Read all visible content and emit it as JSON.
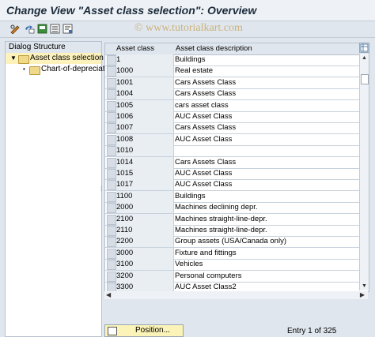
{
  "window": {
    "title": "Change View \"Asset class selection\": Overview"
  },
  "watermark": "© www.tutorialkart.com",
  "toolbar": {
    "icons": [
      "glasses-edit-icon",
      "change-display-icon",
      "save-list-icon",
      "previous-entry-icon",
      "next-entry-icon"
    ]
  },
  "dialog_structure": {
    "header": "Dialog Structure",
    "nodes": [
      {
        "label": "Asset class selection",
        "selected": true
      },
      {
        "label": "Chart-of-depreciation",
        "selected": false
      }
    ]
  },
  "table": {
    "columns": [
      "Asset class",
      "Asset class description"
    ],
    "rows": [
      {
        "code": "1",
        "desc": "Buildings"
      },
      {
        "code": "1000",
        "desc": "Real estate"
      },
      {
        "code": "1001",
        "desc": "Cars Assets Class"
      },
      {
        "code": "1004",
        "desc": "Cars Assets Class"
      },
      {
        "code": "1005",
        "desc": "cars asset class"
      },
      {
        "code": "1006",
        "desc": "AUC Asset Class"
      },
      {
        "code": "1007",
        "desc": "Cars Assets Class"
      },
      {
        "code": "1008",
        "desc": "AUC Asset Class"
      },
      {
        "code": "1010",
        "desc": ""
      },
      {
        "code": "1014",
        "desc": "Cars Assets Class"
      },
      {
        "code": "1015",
        "desc": "AUC Asset Class"
      },
      {
        "code": "1017",
        "desc": "AUC Asset Class"
      },
      {
        "code": "1100",
        "desc": "Buildings"
      },
      {
        "code": "2000",
        "desc": "Machines declining depr."
      },
      {
        "code": "2100",
        "desc": "Machines straight-line-depr."
      },
      {
        "code": "2110",
        "desc": "Machines straight-line-depr."
      },
      {
        "code": "2200",
        "desc": "Group assets (USA/Canada only)"
      },
      {
        "code": "3000",
        "desc": "Fixture and fittings"
      },
      {
        "code": "3100",
        "desc": "Vehicles"
      },
      {
        "code": "3200",
        "desc": "Personal computers"
      },
      {
        "code": "3300",
        "desc": "AUC Asset Class2"
      }
    ]
  },
  "footer": {
    "position_button": "Position...",
    "entry_text": "Entry 1 of 325"
  }
}
